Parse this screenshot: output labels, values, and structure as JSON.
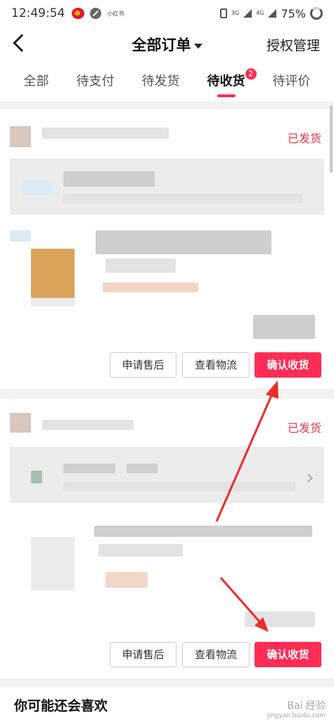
{
  "status_bar": {
    "time": "12:49:54",
    "app_label": "小红书",
    "network_a": "3G",
    "network_b": "4G",
    "battery": "75%"
  },
  "header": {
    "title": "全部订单",
    "auth_label": "授权管理"
  },
  "tabs": [
    {
      "label": "全部",
      "active": false
    },
    {
      "label": "待支付",
      "active": false
    },
    {
      "label": "待发货",
      "active": false
    },
    {
      "label": "待收货",
      "active": true,
      "badge": "2"
    },
    {
      "label": "待评价",
      "active": false
    }
  ],
  "orders": [
    {
      "status": "已发货",
      "buttons": {
        "after_sale": "申请售后",
        "logistics": "查看物流",
        "confirm": "确认收货"
      }
    },
    {
      "status": "已发货",
      "buttons": {
        "after_sale": "申请售后",
        "logistics": "查看物流",
        "confirm": "确认收货"
      }
    }
  ],
  "recommend": {
    "title": "你可能还会喜欢"
  },
  "watermark": {
    "main": "Bai 经验",
    "url": "jingyan.baidu.com"
  },
  "colors": {
    "accent": "#ff2d55",
    "status_red": "#e8364d",
    "annotation_arrow": "#ee2b2b"
  }
}
